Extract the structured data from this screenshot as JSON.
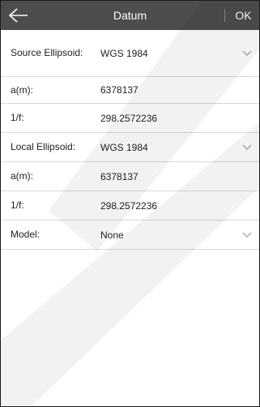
{
  "header": {
    "title": "Datum",
    "ok_label": "OK",
    "back_icon": "arrow-left-icon"
  },
  "rows": [
    {
      "label": "Source Ellipsoid:",
      "value": "WGS 1984",
      "dropdown": true
    },
    {
      "label": "a(m):",
      "value": "6378137"
    },
    {
      "label": "1/f:",
      "value": "298.2572236"
    },
    {
      "label": "Local Ellipsoid:",
      "value": "WGS 1984",
      "dropdown": true
    },
    {
      "label": "a(m):",
      "value": "6378137"
    },
    {
      "label": "1/f:",
      "value": "298.2572236"
    },
    {
      "label": "Model:",
      "value": "None",
      "dropdown": true
    }
  ],
  "colors": {
    "titlebar": "#4d4d4d",
    "divider": "#d9d9d9"
  }
}
